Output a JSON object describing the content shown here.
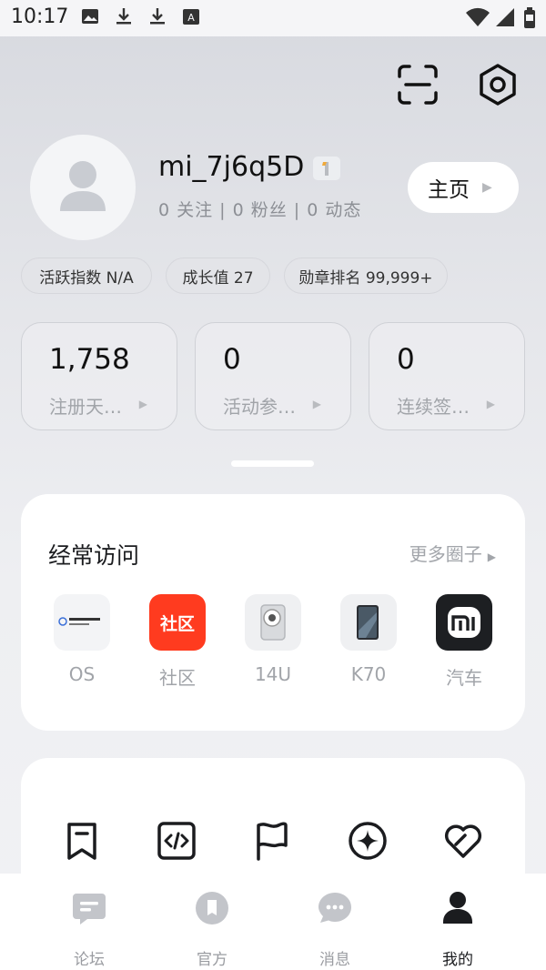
{
  "status_bar": {
    "time": "10:17",
    "left_icons": [
      "image-icon",
      "download-icon",
      "download-icon",
      "translate-icon"
    ],
    "right_icons": [
      "wifi-icon",
      "signal-icon",
      "battery-icon"
    ]
  },
  "top_actions": [
    "scan-icon",
    "settings-icon"
  ],
  "profile": {
    "username": "mi_7j6q5D",
    "level": "1",
    "stats_line": "0 关注 | 0 粉丝 | 0 动态",
    "home_button": "主页"
  },
  "tags": [
    "活跃指数 N/A",
    "成长值 27",
    "勋章排名 99,999+"
  ],
  "stat_cards": [
    {
      "value": "1,758",
      "label": "注册天…"
    },
    {
      "value": "0",
      "label": "活动参…"
    },
    {
      "value": "0",
      "label": "连续签…"
    }
  ],
  "frequent": {
    "title": "经常访问",
    "more": "更多圈子",
    "items": [
      {
        "label": "OS",
        "icon": "hyperos-logo"
      },
      {
        "label": "社区",
        "icon": "community-logo",
        "tile_text": "社区"
      },
      {
        "label": "14U",
        "icon": "phone-14u-image"
      },
      {
        "label": "K70",
        "icon": "phone-k70-image"
      },
      {
        "label": "汽车",
        "icon": "mi-logo"
      }
    ]
  },
  "tools": [
    "bookmark-icon",
    "code-icon",
    "flag-icon",
    "compass-icon",
    "heart-icon"
  ],
  "tabs": [
    {
      "label": "论坛",
      "icon": "forum-icon",
      "active": false
    },
    {
      "label": "官方",
      "icon": "official-icon",
      "active": false
    },
    {
      "label": "消息",
      "icon": "message-icon",
      "active": false
    },
    {
      "label": "我的",
      "icon": "person-icon",
      "active": true
    }
  ],
  "colors": {
    "accent_red": "#ff3b1f",
    "text_primary": "#1b1c1f",
    "text_secondary": "#a1a4a9"
  }
}
